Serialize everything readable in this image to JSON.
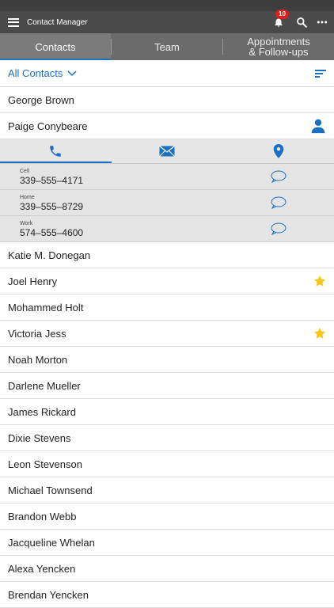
{
  "app": {
    "title": "Contact Manager",
    "notification_count": "10"
  },
  "tabs": [
    {
      "label": "Contacts",
      "active": true
    },
    {
      "label": "Team",
      "active": false
    },
    {
      "label": "Appointments\n& Follow-ups",
      "active": false
    }
  ],
  "filter": {
    "label": "All Contacts"
  },
  "expanded_contact": {
    "name": "Paige Conybeare",
    "phones": [
      {
        "type": "Cell",
        "number": "339–555–4171"
      },
      {
        "type": "Home",
        "number": "339–555–8729"
      },
      {
        "type": "Work",
        "number": "574–555–4600"
      }
    ]
  },
  "contacts_before": [
    {
      "name": "George Brown",
      "starred": false
    }
  ],
  "contacts_after": [
    {
      "name": "Katie M. Donegan",
      "starred": false
    },
    {
      "name": "Joel Henry",
      "starred": true
    },
    {
      "name": "Mohammed Holt",
      "starred": false
    },
    {
      "name": "Victoria Jess",
      "starred": true
    },
    {
      "name": "Noah Morton",
      "starred": false
    },
    {
      "name": "Darlene Mueller",
      "starred": false
    },
    {
      "name": "James Rickard",
      "starred": false
    },
    {
      "name": "Dixie Stevens",
      "starred": false
    },
    {
      "name": "Leon Stevenson",
      "starred": false
    },
    {
      "name": "Michael Townsend",
      "starred": false
    },
    {
      "name": "Brandon Webb",
      "starred": false
    },
    {
      "name": "Jacqueline Whelan",
      "starred": false
    },
    {
      "name": "Alexa Yencken",
      "starred": false
    },
    {
      "name": "Brendan Yencken",
      "starred": false
    }
  ],
  "colors": {
    "accent": "#1a6fc2",
    "star": "#f5c518",
    "badge": "#d9201d"
  },
  "icons": [
    "menu-icon",
    "bell-icon",
    "search-icon",
    "more-icon",
    "chevron-down-icon",
    "sort-icon",
    "person-icon",
    "phone-icon",
    "mail-icon",
    "location-icon",
    "sms-icon",
    "star-icon"
  ]
}
